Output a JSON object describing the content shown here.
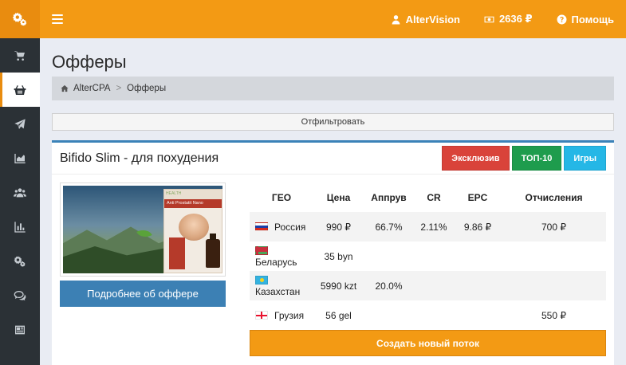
{
  "topbar": {
    "user": "AlterVision",
    "balance": "2636 ₽",
    "help": "Помощь"
  },
  "page": {
    "title": "Офферы"
  },
  "breadcrumb": {
    "home": "AlterCPA",
    "separator": ">",
    "current": "Офферы"
  },
  "filter": {
    "label": "Отфильтровать"
  },
  "offer": {
    "title": "Bifido Slim - для похудения",
    "tags": [
      {
        "label": "Эксклюзив",
        "color": "#d9433a"
      },
      {
        "label": "ТОП-10",
        "color": "#1e9c4d"
      },
      {
        "label": "Игры",
        "color": "#25b7e6"
      }
    ],
    "image": {
      "brand": "HEALTH",
      "product": "Anti Prostatit Nano"
    },
    "more_label": "Подробнее об оффере",
    "create_label": "Создать новый поток",
    "table": {
      "headers": [
        "ГЕО",
        "Цена",
        "Аппрув",
        "CR",
        "EPC",
        "Отчисления"
      ],
      "rows": [
        {
          "flag": "ru",
          "country": "Россия",
          "price": "990 ₽",
          "approve": "66.7%",
          "cr": "2.11%",
          "epc": "9.86 ₽",
          "payout": "700 ₽"
        },
        {
          "flag": "by",
          "country": "Беларусь",
          "price": "35 byn",
          "approve": "",
          "cr": "",
          "epc": "",
          "payout": ""
        },
        {
          "flag": "kz",
          "country": "Казахстан",
          "price": "5990 kzt",
          "approve": "20.0%",
          "cr": "",
          "epc": "",
          "payout": ""
        },
        {
          "flag": "ge",
          "country": "Грузия",
          "price": "56 gel",
          "approve": "",
          "cr": "",
          "epc": "",
          "payout": "550 ₽"
        }
      ]
    }
  },
  "colors": {
    "accent": "#f39a14",
    "sidebar": "#2b3136",
    "primary": "#3c80b4"
  }
}
